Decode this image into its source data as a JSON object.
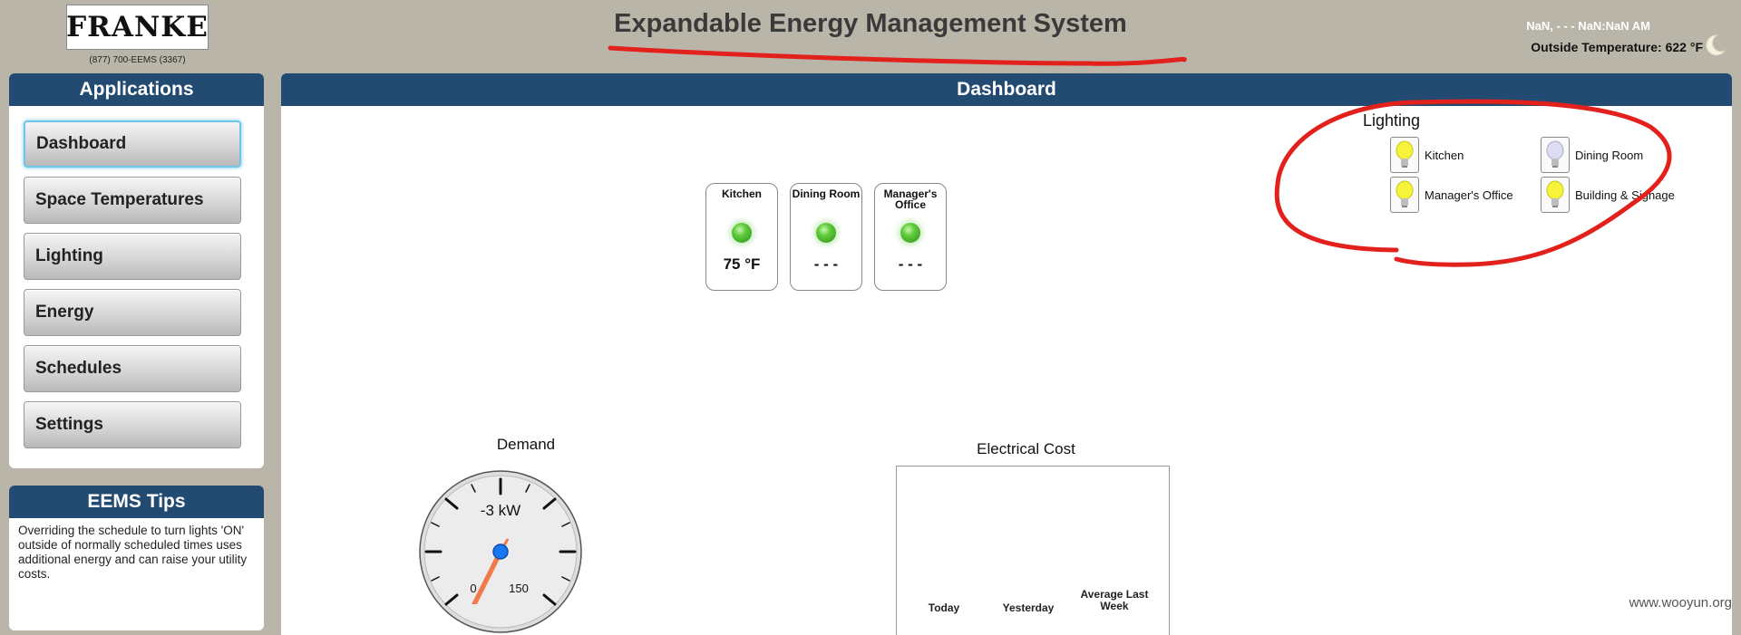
{
  "header": {
    "logo": "FRANKE",
    "phone": "(877) 700-EEMS (3367)",
    "title": "Expandable Energy Management System",
    "datetime": "NaN, - - - NaN:NaN AM",
    "outside_temperature": "Outside Temperature: 622 °F",
    "weather_icon": "moon-icon"
  },
  "applications": {
    "title": "Applications",
    "items": [
      {
        "label": "Dashboard",
        "active": true
      },
      {
        "label": "Space Temperatures",
        "active": false
      },
      {
        "label": "Lighting",
        "active": false
      },
      {
        "label": "Energy",
        "active": false
      },
      {
        "label": "Schedules",
        "active": false
      },
      {
        "label": "Settings",
        "active": false
      }
    ]
  },
  "tips": {
    "title": "EEMS Tips",
    "text": "Overriding the schedule to turn lights 'ON' outside of normally scheduled times uses additional energy and can raise your utility costs."
  },
  "dashboard": {
    "title": "Dashboard",
    "rooms": [
      {
        "name": "Kitchen",
        "temp": "75 °F",
        "status_color": "#3cb62a"
      },
      {
        "name": "Dining Room",
        "temp": "- - -",
        "status_color": "#3cb62a"
      },
      {
        "name": "Manager's Office",
        "temp": "- - -",
        "status_color": "#3cb62a"
      }
    ],
    "lighting": {
      "title": "Lighting",
      "items": [
        {
          "label": "Kitchen",
          "state": "on"
        },
        {
          "label": "Dining Room",
          "state": "off"
        },
        {
          "label": "Manager's Office",
          "state": "on"
        },
        {
          "label": "Building & Signage",
          "state": "on"
        }
      ]
    },
    "demand": {
      "title": "Demand",
      "value": "-3 kW",
      "tick_0": "0",
      "tick_150": "150"
    },
    "electrical_cost": {
      "title": "Electrical Cost",
      "labels": [
        "Today",
        "Yesterday",
        "Average Last Week"
      ]
    }
  },
  "watermark": "www.wooyun.org",
  "colors": {
    "header_bg": "#b9b6a9",
    "panel_head": "#234b72",
    "annotation": "#e3211c"
  }
}
